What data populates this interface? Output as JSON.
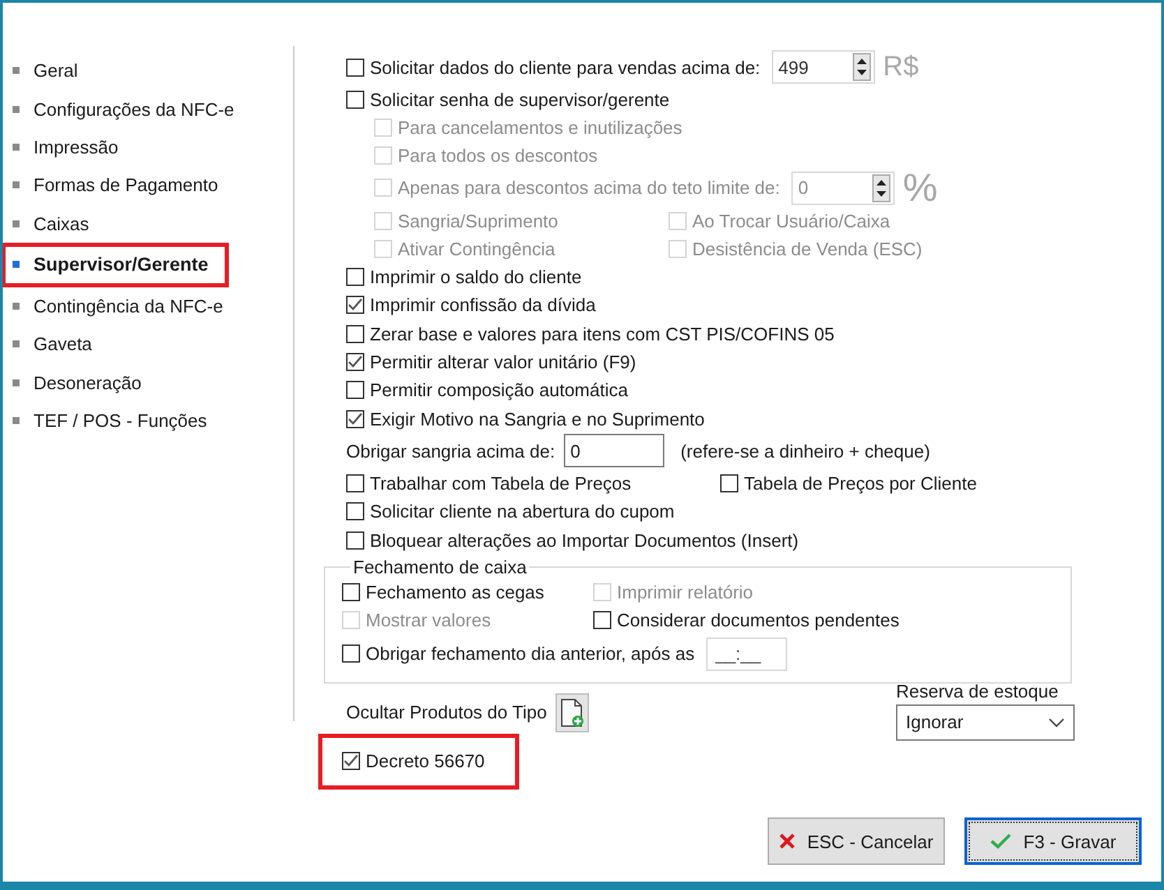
{
  "sidebar": {
    "items": [
      {
        "label": "Geral",
        "selected": false,
        "highlighted": false
      },
      {
        "label": "Configurações da NFC-e",
        "selected": false,
        "highlighted": false
      },
      {
        "label": "Impressão",
        "selected": false,
        "highlighted": false
      },
      {
        "label": "Formas de Pagamento",
        "selected": false,
        "highlighted": false
      },
      {
        "label": "Caixas",
        "selected": false,
        "highlighted": false
      },
      {
        "label": "Supervisor/Gerente",
        "selected": true,
        "highlighted": true
      },
      {
        "label": "Contingência da NFC-e",
        "selected": false,
        "highlighted": false
      },
      {
        "label": "Gaveta",
        "selected": false,
        "highlighted": false
      },
      {
        "label": "Desoneração",
        "selected": false,
        "highlighted": false
      },
      {
        "label": "TEF / POS - Funções",
        "selected": false,
        "highlighted": false
      }
    ]
  },
  "rows": [
    {
      "kind": "check_spin",
      "label": "Solicitar dados do cliente para vendas acima de:",
      "checked": false,
      "disabled": false,
      "value": "499",
      "unit": "R$"
    },
    {
      "kind": "check",
      "label": "Solicitar senha de supervisor/gerente",
      "checked": false,
      "disabled": false,
      "children": [
        {
          "kind": "check",
          "label": "Para cancelamentos e inutilizações",
          "checked": false,
          "disabled": true
        },
        {
          "kind": "check",
          "label": "Para todos os descontos",
          "checked": false,
          "disabled": true
        },
        {
          "kind": "check_spin",
          "label": "Apenas para descontos acima do teto limite de:",
          "checked": false,
          "disabled": true,
          "value": "0",
          "unit": "%"
        },
        {
          "kind": "check_pair",
          "items": [
            {
              "label": "Sangria/Suprimento",
              "checked": false,
              "disabled": true
            },
            {
              "label": "Ao Trocar Usuário/Caixa",
              "checked": false,
              "disabled": true
            }
          ]
        },
        {
          "kind": "check_pair",
          "items": [
            {
              "label": "Ativar Contingência",
              "checked": false,
              "disabled": true
            },
            {
              "label": "Desistência de Venda (ESC)",
              "checked": false,
              "disabled": true
            }
          ]
        }
      ]
    },
    {
      "kind": "check",
      "label": "Imprimir o saldo do cliente",
      "checked": false,
      "disabled": false
    },
    {
      "kind": "check",
      "label": "Imprimir confissão da dívida",
      "checked": true,
      "disabled": false
    },
    {
      "kind": "check",
      "label": "Zerar base e valores para itens com CST PIS/COFINS 05",
      "checked": false,
      "disabled": false
    },
    {
      "kind": "check",
      "label": "Permitir alterar valor unitário (F9)",
      "checked": true,
      "disabled": false
    },
    {
      "kind": "check",
      "label": "Permitir composição automática",
      "checked": false,
      "disabled": false
    },
    {
      "kind": "check",
      "label": "Exigir Motivo na Sangria e no Suprimento",
      "checked": true,
      "disabled": false
    },
    {
      "kind": "input",
      "label": "Obrigar sangria acima de:",
      "value": "0",
      "note": "(refere-se a dinheiro  + cheque)"
    },
    {
      "kind": "check_pair",
      "items": [
        {
          "label": "Trabalhar com Tabela de Preços",
          "checked": false,
          "disabled": false
        },
        {
          "label": "Tabela de Preços por Cliente",
          "checked": false,
          "disabled": false
        }
      ]
    },
    {
      "kind": "check",
      "label": "Solicitar cliente na abertura do cupom",
      "checked": false,
      "disabled": false
    },
    {
      "kind": "check",
      "label": "Bloquear alterações ao Importar Documentos (Insert)",
      "checked": false,
      "disabled": false
    }
  ],
  "closing_group": {
    "title": "Fechamento de caixa",
    "rows": [
      {
        "kind": "check_pair",
        "items": [
          {
            "label": "Fechamento as cegas",
            "checked": false,
            "disabled": false
          },
          {
            "label": "Imprimir relatório",
            "checked": false,
            "disabled": true
          }
        ]
      },
      {
        "kind": "check_pair",
        "items": [
          {
            "label": "Mostrar valores",
            "checked": false,
            "disabled": true
          },
          {
            "label": "Considerar documentos pendentes",
            "checked": false,
            "disabled": false
          }
        ]
      },
      {
        "kind": "check_time",
        "label": "Obrigar fechamento dia anterior, após as",
        "checked": false,
        "disabled": false,
        "value": "__:__"
      }
    ]
  },
  "hide_products": {
    "label": "Ocultar Produtos do Tipo"
  },
  "decree": {
    "label": "Decreto 56670",
    "checked": true,
    "highlighted": true
  },
  "stock_reserve": {
    "label": "Reserva de estoque",
    "value": "Ignorar"
  },
  "buttons": [
    {
      "label": "ESC - Cancelar",
      "kind": "cancel",
      "focused": false
    },
    {
      "label": "F3 - Gravar",
      "kind": "save",
      "focused": true
    }
  ]
}
